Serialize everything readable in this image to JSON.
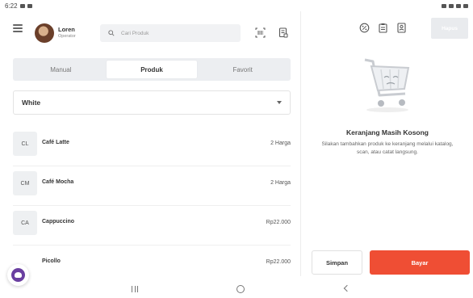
{
  "status_bar": {
    "time": "6:22"
  },
  "user": {
    "name": "Loren",
    "role": "Operator"
  },
  "search": {
    "placeholder": "Cari Produk"
  },
  "tabs": [
    {
      "label": "Manual",
      "active": false
    },
    {
      "label": "Produk",
      "active": true
    },
    {
      "label": "Favorit",
      "active": false
    }
  ],
  "category": {
    "selected": "White"
  },
  "products": [
    {
      "abbr": "CL",
      "name": "Café Latte",
      "price": "2 Harga"
    },
    {
      "abbr": "CM",
      "name": "Café Mocha",
      "price": "2 Harga"
    },
    {
      "abbr": "CA",
      "name": "Cappuccino",
      "price": "Rp22.000"
    },
    {
      "abbr": "",
      "name": "Picollo",
      "price": "Rp22.000"
    }
  ],
  "cart": {
    "delete_label": "Hapus",
    "empty_title": "Keranjang Masih Kosong",
    "empty_desc": "Silakan tambahkan produk ke keranjang melalui katalog, scan, atau catat langsung.",
    "save_label": "Simpan",
    "pay_label": "Bayar"
  },
  "colors": {
    "accent": "#ef4e34",
    "fab": "#6a3fa0"
  },
  "icons": [
    "menu-icon",
    "search-icon",
    "barcode-icon",
    "receipt-icon",
    "discount-icon",
    "clipboard-icon",
    "customer-icon",
    "cart-icon"
  ]
}
